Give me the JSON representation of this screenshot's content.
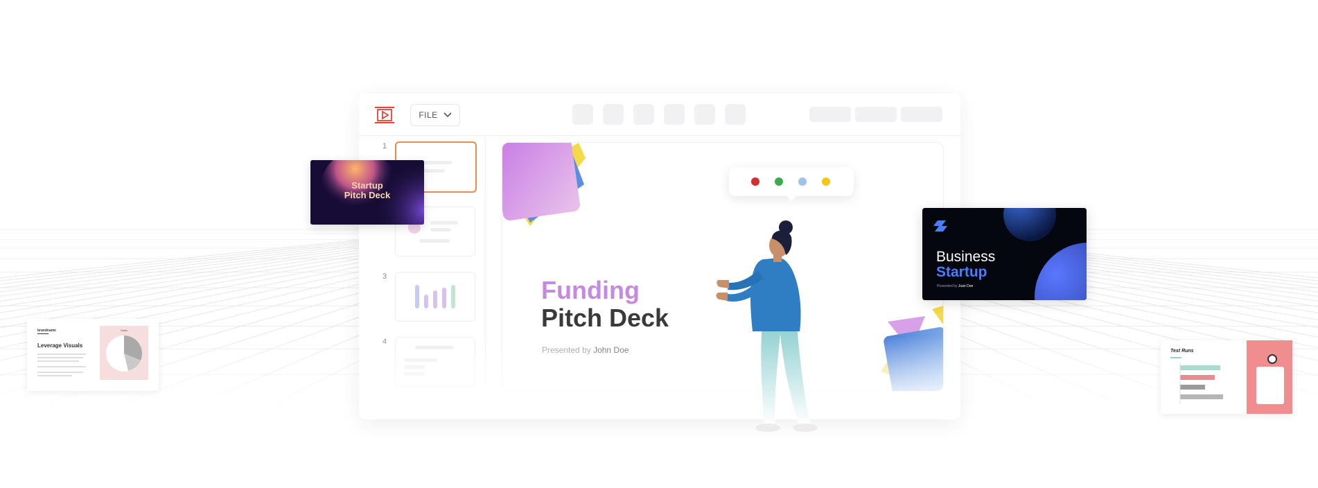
{
  "toolbar": {
    "file_label": "FILE"
  },
  "slides_panel": {
    "numbers": [
      "1",
      "3",
      "4"
    ]
  },
  "main_slide": {
    "title_line1": "Funding",
    "title_line2": "Pitch Deck",
    "presented_prefix": "Presented by",
    "presenter": "John Doe"
  },
  "color_picker": {
    "colors": [
      "#d32f2f",
      "#3daa4e",
      "#9ec3e6",
      "#f5c518"
    ]
  },
  "card_startup": {
    "line1": "Startup",
    "line2": "Pitch Deck"
  },
  "card_business": {
    "line1": "Business",
    "line2": "Startup",
    "presented_prefix": "Presented by",
    "presenter": "Joan Doe"
  },
  "card_visuals": {
    "brand": "brandname",
    "title": "Leverage Visuals",
    "chart_title": "Sales"
  },
  "card_runs": {
    "title": "Test Runs"
  },
  "theme": {
    "accent_orange": "#f08a4b",
    "logo_red": "#e0443a",
    "title_purple": "#c48ae0",
    "business_blue": "#4a7dff"
  }
}
